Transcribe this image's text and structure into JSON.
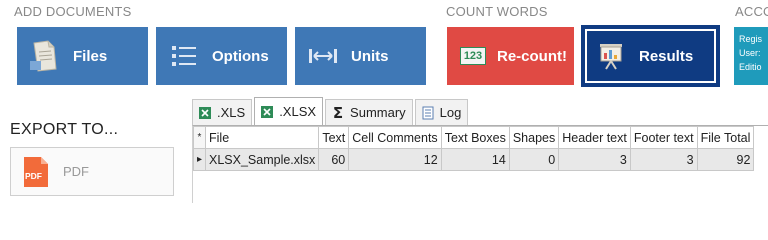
{
  "sections": {
    "add_documents": "ADD DOCUMENTS",
    "count_words": "COUNT WORDS",
    "account": "ACCO"
  },
  "tiles": {
    "files": "Files",
    "options": "Options",
    "units": "Units",
    "recount": "Re-count!",
    "results": "Results",
    "recount_badge": "123"
  },
  "account_tile": {
    "line1": "Regis",
    "line2": "User:",
    "line3": "Editio"
  },
  "export": {
    "label": "EXPORT TO...",
    "pdf_button": "PDF",
    "pdf_icon_text": "PDF"
  },
  "tabs": [
    {
      "label": ".XLS",
      "icon": "excel-icon",
      "active": false
    },
    {
      "label": ".XLSX",
      "icon": "excel-icon",
      "active": true
    },
    {
      "label": "Summary",
      "icon": "sigma-icon",
      "active": false
    },
    {
      "label": "Log",
      "icon": "log-icon",
      "active": false
    }
  ],
  "table": {
    "new_row_marker": "*",
    "columns": [
      "File",
      "Text",
      "Cell Comments",
      "Text Boxes",
      "Shapes",
      "Header text",
      "Footer  text",
      "File Total"
    ],
    "rows": [
      [
        "XLSX_Sample.xlsx",
        "60",
        "12",
        "14",
        "0",
        "3",
        "3",
        "92"
      ]
    ]
  },
  "colors": {
    "tile_blue": "#3f78b6",
    "tile_red": "#e04a44",
    "tile_dark": "#0f3b82",
    "account_teal": "#1f9bbb"
  }
}
